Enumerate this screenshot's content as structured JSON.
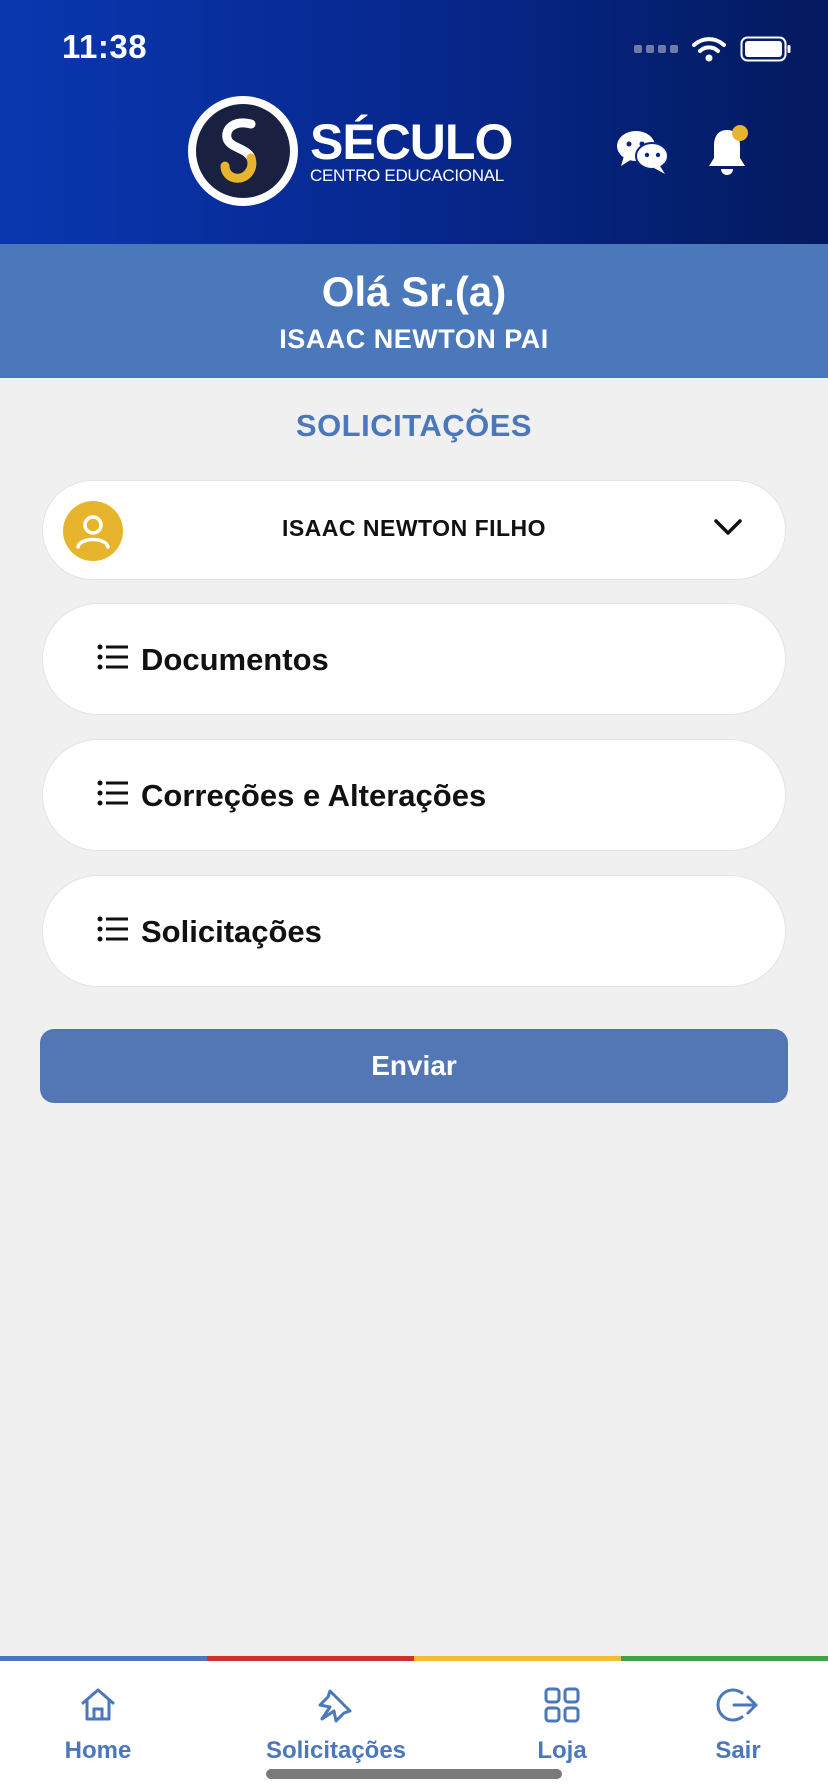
{
  "status_bar": {
    "time": "11:38"
  },
  "logo": {
    "name": "SÉCULO",
    "subtitle": "CENTRO EDUCACIONAL"
  },
  "greeting": {
    "title": "Olá Sr.(a)",
    "name": "ISAAC NEWTON PAI"
  },
  "section_title": "SOLICITAÇÕES",
  "student_selector": {
    "selected": "ISAAC NEWTON FILHO"
  },
  "menu": {
    "items": [
      {
        "label": "Documentos"
      },
      {
        "label": "Correções e Alterações"
      },
      {
        "label": "Solicitações"
      }
    ]
  },
  "send_button": "Enviar",
  "bottom_nav": {
    "items": [
      {
        "label": "Home",
        "icon": "home-icon"
      },
      {
        "label": "Solicitações",
        "icon": "pin-icon"
      },
      {
        "label": "Loja",
        "icon": "grid-icon"
      },
      {
        "label": "Sair",
        "icon": "logout-icon"
      }
    ],
    "stripe_colors": [
      "#4a78ba",
      "#d32f2f",
      "#f0c034",
      "#43a047"
    ]
  },
  "colors": {
    "header_start": "#0a37b0",
    "header_end": "#041a5e",
    "accent_blue": "#4a78ba",
    "avatar_gold": "#e7b52d"
  }
}
